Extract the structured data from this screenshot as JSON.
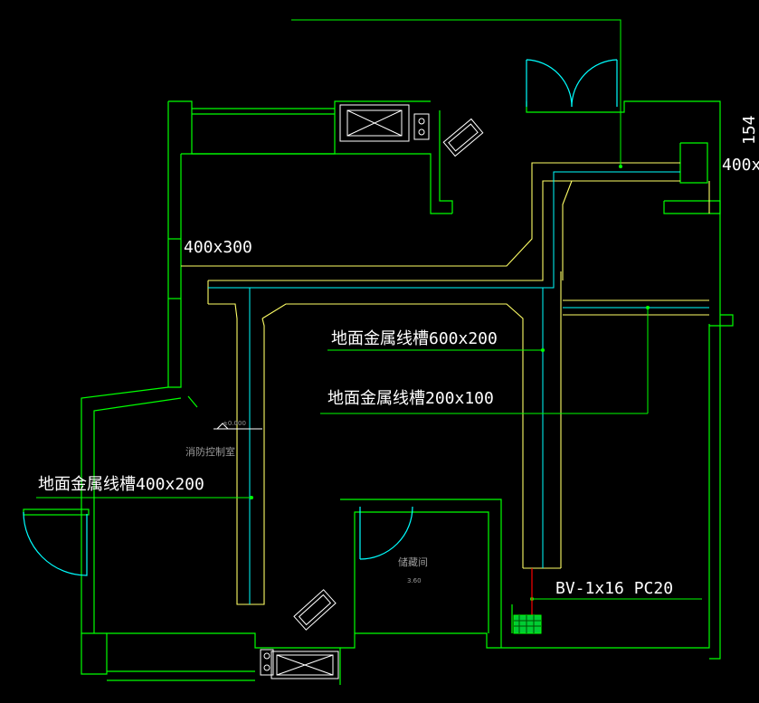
{
  "drawing": {
    "background": "#000000",
    "colors": {
      "wall": "#00ff00",
      "tray": "#ffff66",
      "cable": "#00ffff",
      "leader": "#00ff00",
      "text": "#ffffff",
      "room_text": "#9a9a9a",
      "cable_red": "#ff0000",
      "equipment": "#00cc33"
    },
    "labels": {
      "tray_400x300": "400x300",
      "tray_600x200": "地面金属线槽600x200",
      "tray_200x100": "地面金属线槽200x100",
      "tray_400x200": "地面金属线槽400x200",
      "cable_spec": "BV-1x16 PC20",
      "edge_dim": "400x",
      "edge_dim_rotated": "154",
      "room_fire_control": "消防控制室",
      "room_storage": "储藏间",
      "elevation": "±0.000",
      "room_height": "3.60"
    }
  }
}
